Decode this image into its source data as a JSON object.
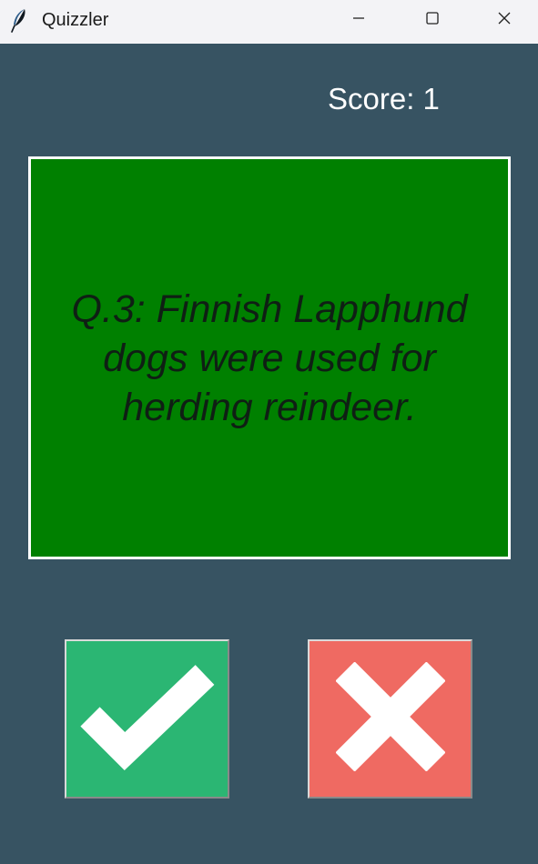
{
  "window": {
    "title": "Quizzler",
    "app_icon": "feather-icon",
    "controls": [
      "minimize-icon",
      "maximize-icon",
      "close-icon"
    ]
  },
  "quiz": {
    "score_text": "Score: 1",
    "question_text": "Q.3: Finnish Lapphund dogs were used for herding reindeer."
  },
  "buttons": {
    "true_icon": "checkmark-icon",
    "false_icon": "cross-icon"
  },
  "colors": {
    "background": "#375362",
    "question_card": "#008000",
    "true_button": "#2bb673",
    "false_button": "#ef6a62",
    "titlebar": "#f3f3f6"
  }
}
